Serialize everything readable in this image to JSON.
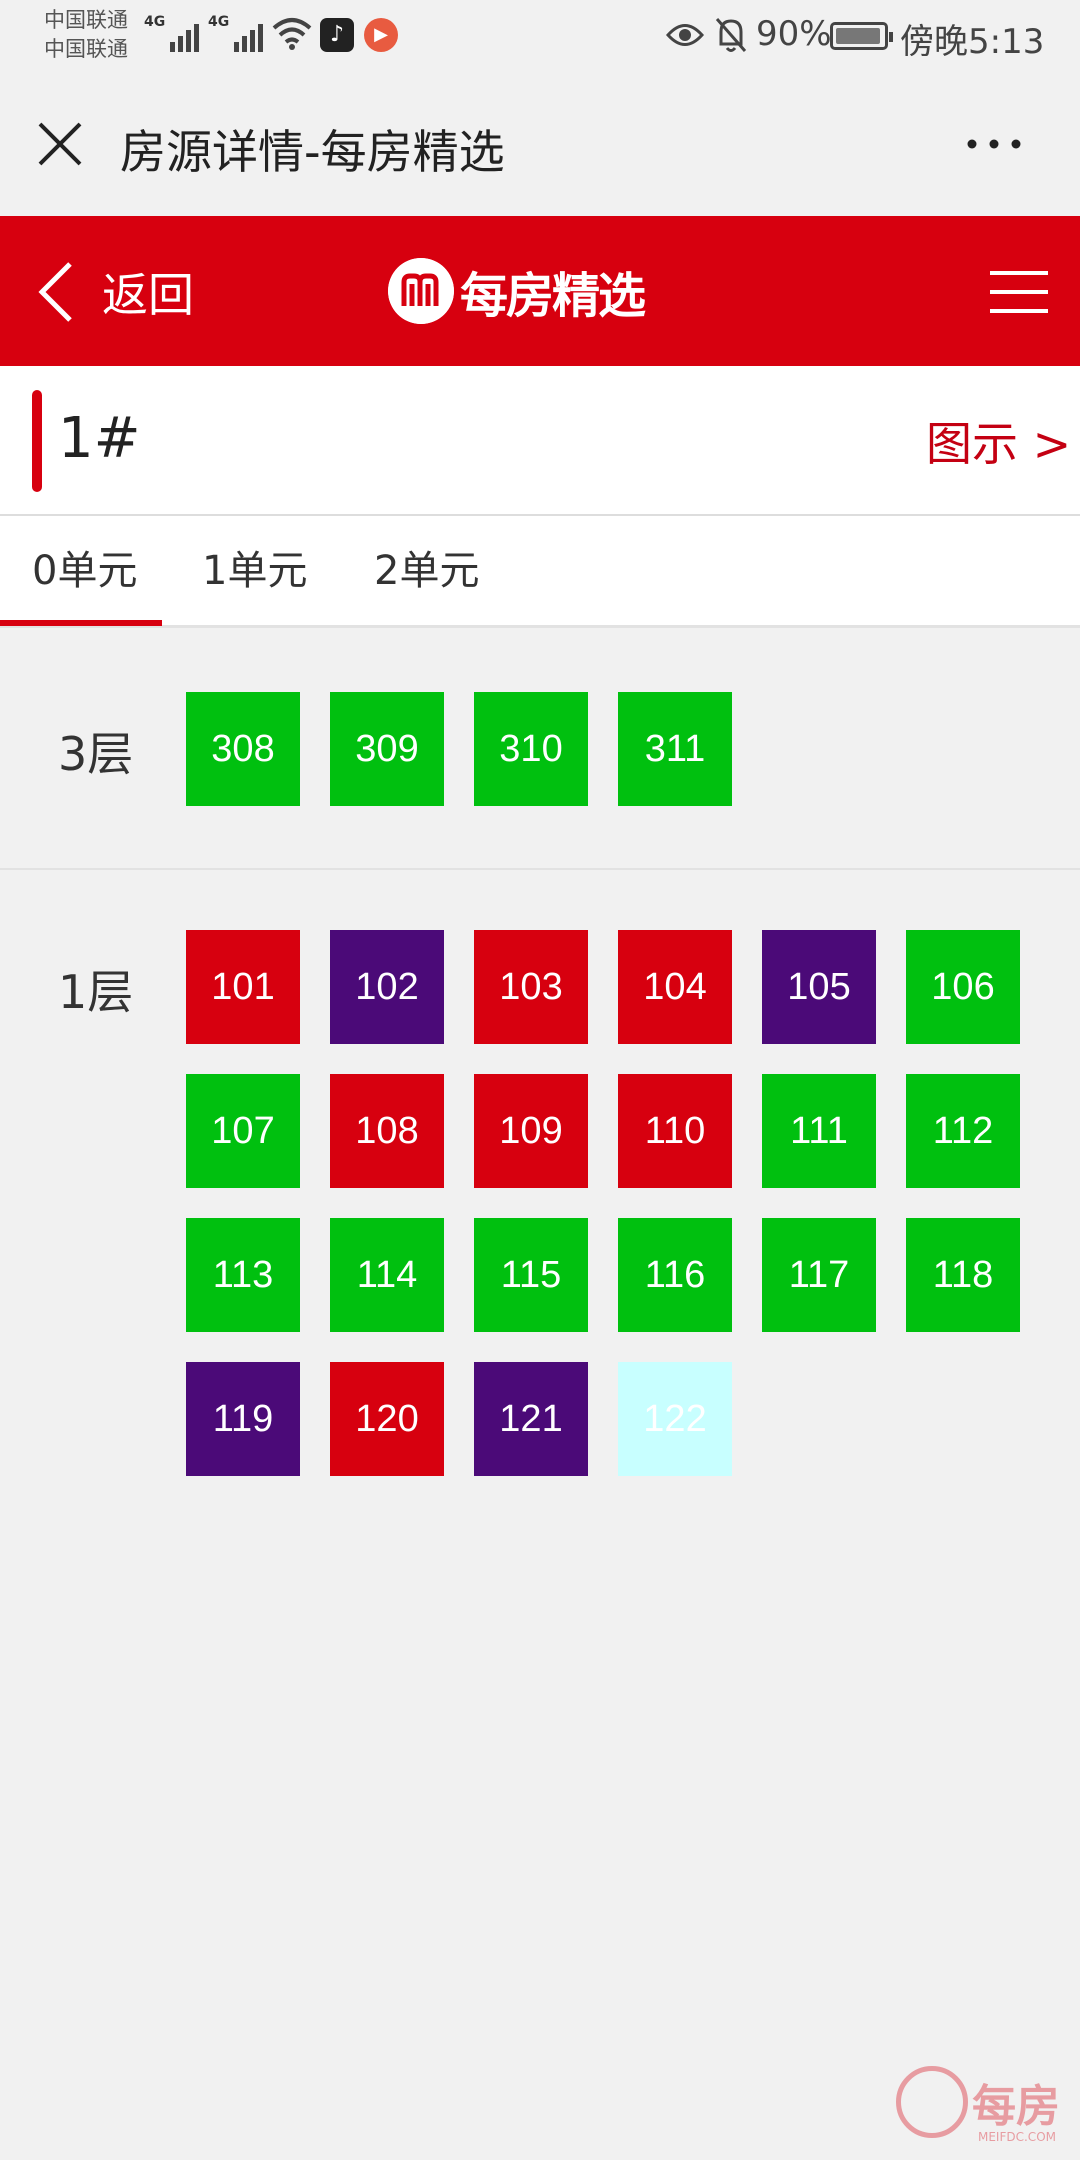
{
  "status_bar": {
    "carrier_1": "中国联通",
    "carrier_2": "中国联通",
    "network_1": "4G",
    "network_2": "4G",
    "battery": "90%",
    "time": "傍晚5:13"
  },
  "titlebar": {
    "title": "房源详情-每房精选"
  },
  "header": {
    "back_label": "返回",
    "logo_text": "每房精选"
  },
  "building": {
    "name": "1#",
    "legend_link": "图示 >"
  },
  "tabs": [
    {
      "label": "0单元",
      "active": true
    },
    {
      "label": "1单元",
      "active": false
    },
    {
      "label": "2单元",
      "active": false
    }
  ],
  "colors": {
    "available": "#00c00f",
    "sold": "#d7000f",
    "reserved": "#4b0a78",
    "other": "#c8ffff",
    "brand": "#d7000f"
  },
  "floors": [
    {
      "label": "3层",
      "units": [
        {
          "no": "308",
          "status": "available"
        },
        {
          "no": "309",
          "status": "available"
        },
        {
          "no": "310",
          "status": "available"
        },
        {
          "no": "311",
          "status": "available"
        }
      ]
    },
    {
      "label": "1层",
      "units": [
        {
          "no": "101",
          "status": "sold"
        },
        {
          "no": "102",
          "status": "reserved"
        },
        {
          "no": "103",
          "status": "sold"
        },
        {
          "no": "104",
          "status": "sold"
        },
        {
          "no": "105",
          "status": "reserved"
        },
        {
          "no": "106",
          "status": "available"
        },
        {
          "no": "107",
          "status": "available"
        },
        {
          "no": "108",
          "status": "sold"
        },
        {
          "no": "109",
          "status": "sold"
        },
        {
          "no": "110",
          "status": "sold"
        },
        {
          "no": "111",
          "status": "available"
        },
        {
          "no": "112",
          "status": "available"
        },
        {
          "no": "113",
          "status": "available"
        },
        {
          "no": "114",
          "status": "available"
        },
        {
          "no": "115",
          "status": "available"
        },
        {
          "no": "116",
          "status": "available"
        },
        {
          "no": "117",
          "status": "available"
        },
        {
          "no": "118",
          "status": "available"
        },
        {
          "no": "119",
          "status": "reserved"
        },
        {
          "no": "120",
          "status": "sold"
        },
        {
          "no": "121",
          "status": "reserved"
        },
        {
          "no": "122",
          "status": "other"
        }
      ]
    }
  ],
  "watermark": {
    "text": "每房",
    "sub": "MEIFDC.COM"
  }
}
